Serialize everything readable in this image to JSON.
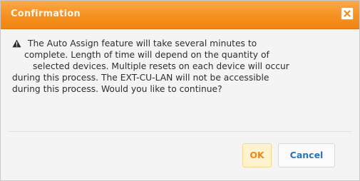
{
  "dialog": {
    "title": "Confirmation",
    "close_icon": "close-icon",
    "warning_icon": "warning-icon",
    "message_lines": [
      "The Auto Assign feature will take several minutes to",
      "complete. Length of time will depend on the quantity of",
      "selected devices. Multiple resets on each device will occur",
      "during this process. The EXT-CU-LAN will not be accessible",
      "during this process. Would you like to continue?"
    ],
    "ok_label": "OK",
    "cancel_label": "Cancel"
  },
  "colors": {
    "titlebar": "#f5901f",
    "ok_text": "#e88a1a",
    "ok_background": "#fff3cf",
    "cancel_text": "#2a74b8"
  }
}
